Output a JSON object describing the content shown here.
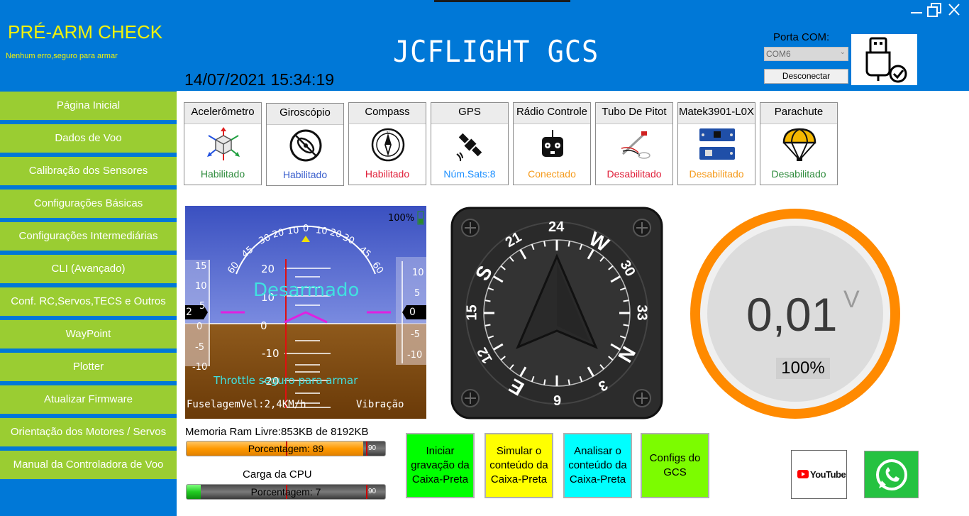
{
  "header": {
    "prearm_title": "PRÉ-ARM CHECK",
    "prearm_status": "Nenhum erro,seguro para armar",
    "app_title": "JCFLIGHT GCS",
    "datetime": "14/07/2021 15:34:19",
    "porta_label": "Porta COM:",
    "com_value": "COM6",
    "disconnect_label": "Desconectar",
    "brand_color": "#0078d7",
    "title_color": "#f2f20a"
  },
  "sidebar": {
    "color": "#9acd32",
    "items": [
      {
        "label": "Página Inicial"
      },
      {
        "label": "Dados de Voo"
      },
      {
        "label": "Calibração dos Sensores"
      },
      {
        "label": "Configurações Básicas"
      },
      {
        "label": "Configurações Intermediárias"
      },
      {
        "label": "CLI (Avançado)"
      },
      {
        "label": "Conf. RC,Servos,TECS e Outros"
      },
      {
        "label": "WayPoint"
      },
      {
        "label": "Plotter"
      },
      {
        "label": "Atualizar Firmware"
      },
      {
        "label": "Orientação dos Motores / Servos"
      },
      {
        "label": "Manual da Controladora de Voo"
      }
    ]
  },
  "sensors": [
    {
      "title": "Acelerômetro",
      "status": "Habilitado",
      "status_color": "#2e8b3c",
      "icon": "accelerometer-icon"
    },
    {
      "title": "Giroscópio",
      "status": "Habilitado",
      "status_color": "#3a5fcd",
      "icon": "gyroscope-icon"
    },
    {
      "title": "Compass",
      "status": "Habilitado",
      "status_color": "#e0203a",
      "icon": "compass-icon"
    },
    {
      "title": "GPS",
      "status": "Núm.Sats:8",
      "status_color": "#1e90ff",
      "icon": "satellite-icon"
    },
    {
      "title": "Rádio Controle",
      "status": "Conectado",
      "status_color": "#f59a1a",
      "icon": "radio-controller-icon"
    },
    {
      "title": "Tubo De Pitot",
      "status": "Desabilitado",
      "status_color": "#e0203a",
      "icon": "pitot-tube-icon"
    },
    {
      "title": "Matek3901-L0X",
      "status": "Desabilitado",
      "status_color": "#f59a1a",
      "icon": "optical-flow-board-icon"
    },
    {
      "title": "Parachute",
      "status": "Desabilitado",
      "status_color": "#2e8b3c",
      "icon": "parachute-icon"
    }
  ],
  "hud": {
    "battery": "100%",
    "state": "Desarmado",
    "throttle_msg": "Throttle seguro para armar",
    "speed": "FuselagemVel:2,4KM/h",
    "vibration": "Vibração",
    "roll_left_labels": [
      "60",
      "45",
      "30",
      "20",
      "10"
    ],
    "roll_center_label": "0",
    "roll_right_labels": [
      "10",
      "20",
      "30",
      "45",
      "60"
    ],
    "pitch_labels": [
      "20",
      "10",
      "0",
      "-10",
      "-20"
    ],
    "left_tape_labels": [
      "15",
      "10",
      "5",
      "0",
      "-5",
      "-10"
    ],
    "left_tape_value": "2",
    "right_tape_labels": [
      "10",
      "5",
      "0",
      "-5",
      "-10"
    ],
    "right_tape_value": "0",
    "sky_color": "#4a63c8",
    "ground_color": "#8b4a10"
  },
  "compass": {
    "labels": [
      "24",
      "W",
      "30",
      "33",
      "N",
      "3",
      "6",
      "E",
      "12",
      "15",
      "S",
      "21"
    ]
  },
  "voltage": {
    "value": "0,01",
    "unit": "V",
    "percent": "100%",
    "ring_color": "#ff8a00"
  },
  "ram": {
    "label": "Memoria Ram Livre:853KB de 8192KB",
    "bar_text": "Porcentagem:  89",
    "value": 89,
    "max_label": "90"
  },
  "cpu": {
    "label": "Carga da CPU",
    "bar_text": "Porcentagem:  7",
    "value": 7,
    "max_label": "90"
  },
  "actions": [
    {
      "label": "Iniciar gravação da Caixa-Preta",
      "color": "#00ff00"
    },
    {
      "label": "Simular o conteúdo da Caixa-Preta",
      "color": "#ffff00"
    },
    {
      "label": "Analisar o conteúdo da Caixa-Preta",
      "color": "#00ffff"
    },
    {
      "label": "Configs do GCS",
      "color": "#7cfc00"
    }
  ],
  "social": {
    "youtube": "YouTube"
  }
}
